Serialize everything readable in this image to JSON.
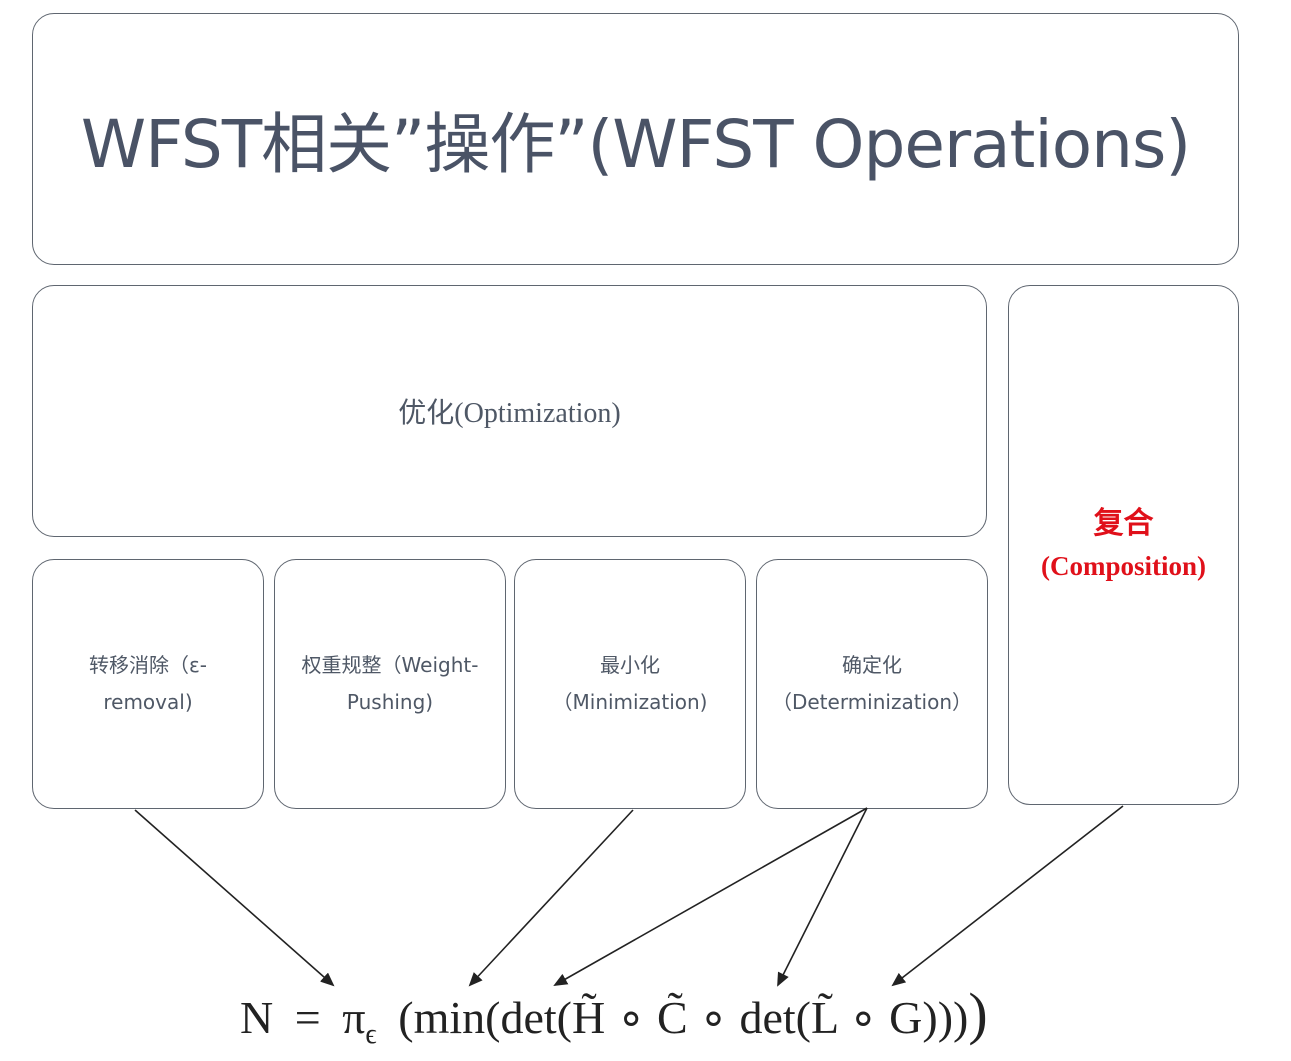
{
  "title": "WFST相关”操作”(WFST Operations)",
  "optimization": "优化(Optimization)",
  "composition": {
    "cn": "复合",
    "en": "(Composition)"
  },
  "sub_ops": [
    {
      "line1": "转移消除（ε-",
      "line2": "removal)"
    },
    {
      "line1": "权重规整（Weight-",
      "line2": "Pushing)"
    },
    {
      "line1": "最小化",
      "line2": "（Minimization)"
    },
    {
      "line1": "确定化",
      "line2": "（Determinization）"
    }
  ],
  "formula": {
    "lhs": "N",
    "eq": "=",
    "pi": "π",
    "eps": "ϵ",
    "rest": "(min(det(H̃ ∘ C̃ ∘ det(L̃ ∘ G)))",
    "close": ")"
  },
  "colors": {
    "border": "#5f6670",
    "text": "#4f5866",
    "accent": "#e0101a"
  }
}
